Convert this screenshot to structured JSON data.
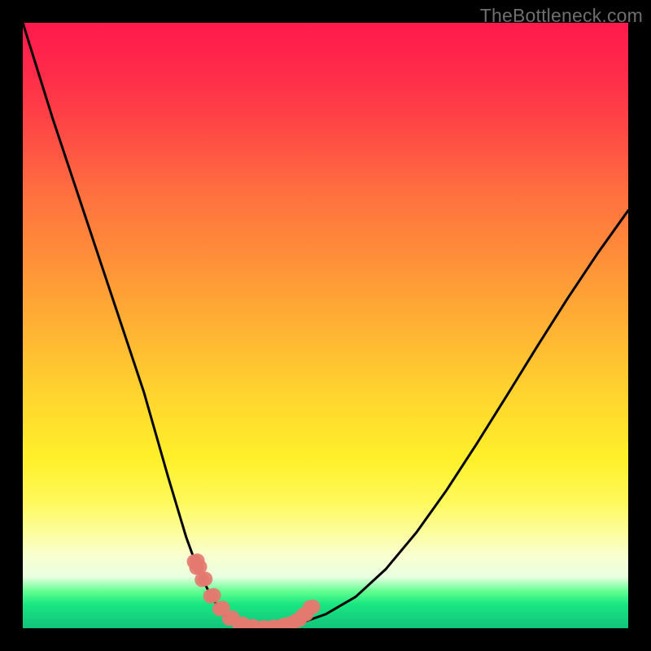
{
  "watermark": "TheBottleneck.com",
  "chart_data": {
    "type": "line",
    "title": "",
    "xlabel": "",
    "ylabel": "",
    "xlim": [
      0,
      100
    ],
    "ylim": [
      0,
      100
    ],
    "x": [
      0,
      5,
      10,
      15,
      20,
      24,
      27,
      29,
      31,
      32.5,
      34,
      35.5,
      37,
      40,
      43,
      46,
      50,
      55,
      60,
      65,
      70,
      75,
      80,
      85,
      90,
      95,
      100
    ],
    "values": [
      100,
      84,
      69,
      54,
      39,
      25,
      15,
      9.5,
      5.5,
      3.2,
      1.6,
      0.6,
      0.2,
      0,
      0.3,
      0.9,
      2.3,
      5.2,
      9.8,
      15.8,
      22.8,
      30.5,
      38.5,
      46.6,
      54.5,
      62.0,
      69.0
    ],
    "markers": {
      "x": [
        28.3,
        28.7,
        29.6,
        31.0,
        32.5,
        34.1,
        35.8,
        37.5,
        39.3,
        41.0,
        42.8,
        44.0,
        45.2,
        46.3,
        47.4
      ],
      "values": [
        11.0,
        10.0,
        8.0,
        5.3,
        3.2,
        1.6,
        0.6,
        0.2,
        0.0,
        0.1,
        0.4,
        0.7,
        1.3,
        2.2,
        3.4
      ]
    }
  }
}
